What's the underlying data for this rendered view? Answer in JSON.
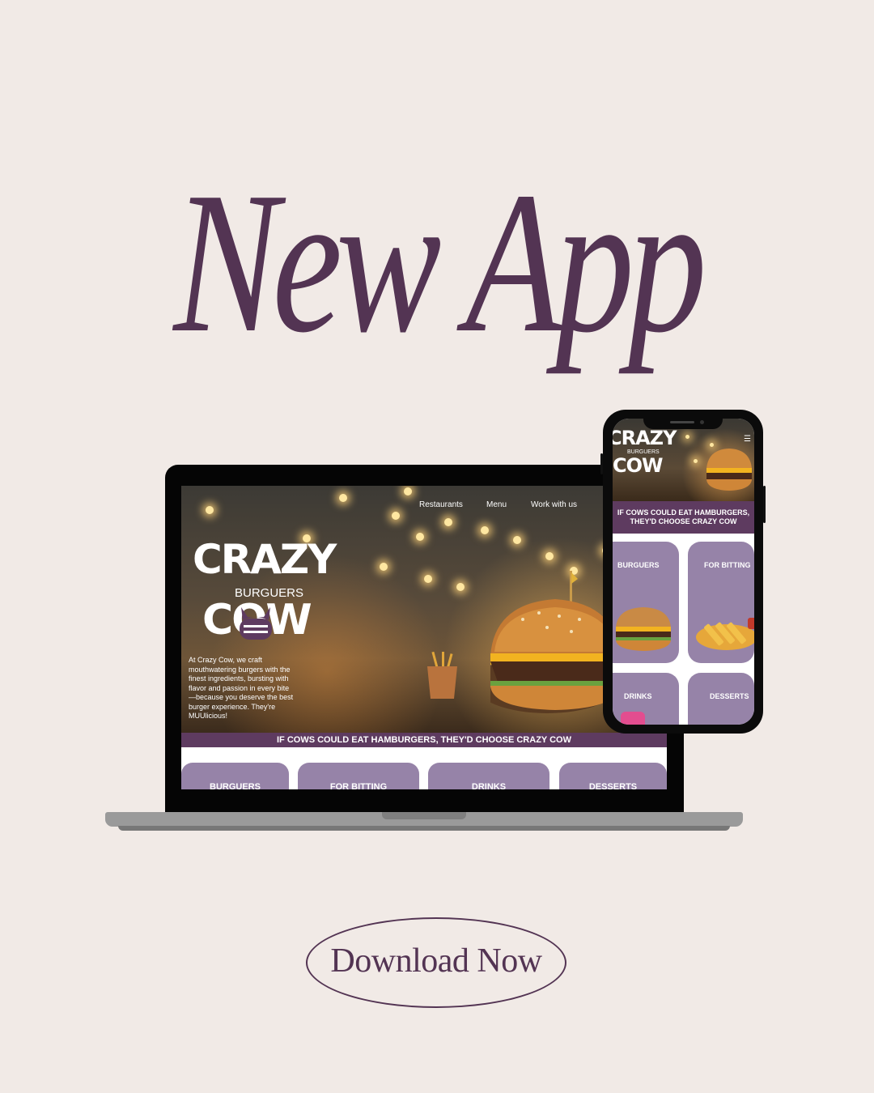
{
  "headline": "New App",
  "laptop_site": {
    "nav": [
      "Restaurants",
      "Menu",
      "Work with us"
    ],
    "logo": {
      "top": "CRAZY",
      "middle": "BURGUERS",
      "bottom": "COW"
    },
    "about": "At Crazy Cow, we craft mouthwatering burgers with the finest ingredients, bursting with flavor and passion in every bite—because you deserve the best burger experience. They're MUUlicious!",
    "banner": "IF COWS COULD EAT HAMBURGERS, THEY'D CHOOSE CRAZY COW",
    "categories": [
      "BURGUERS",
      "FOR BITTING",
      "DRINKS",
      "DESSERTS"
    ]
  },
  "phone_site": {
    "logo": {
      "top": "CRAZY",
      "middle": "BURGUERS",
      "bottom": "COW"
    },
    "menu_icon": "hamburger-menu-icon",
    "banner": "IF COWS COULD EAT HAMBURGERS, THEY'D CHOOSE CRAZY COW",
    "categories": [
      "BURGUERS",
      "FOR BITTING",
      "DRINKS",
      "DESSERTS"
    ]
  },
  "cta": {
    "label": "Download Now"
  },
  "colors": {
    "background": "#f1eae6",
    "brand_purple": "#533453",
    "banner_purple": "#5e3b60",
    "card_lavender": "#9683a8"
  }
}
